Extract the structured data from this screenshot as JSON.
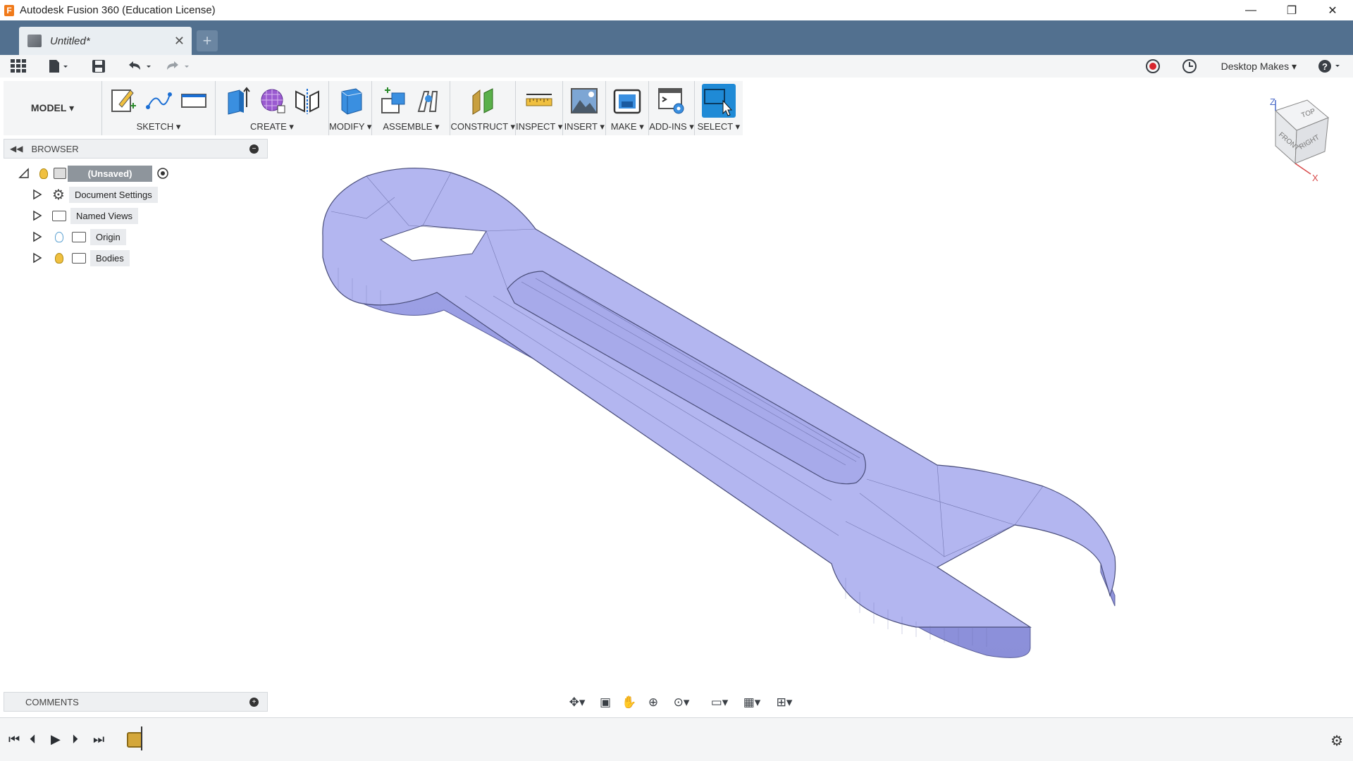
{
  "window": {
    "title": "Autodesk Fusion 360 (Education License)",
    "controls": {
      "minimize": "—",
      "restore": "❐",
      "close": "✕"
    }
  },
  "tabs": {
    "document_tab": "Untitled*",
    "close_glyph": "✕",
    "new_tab_glyph": "+"
  },
  "quick_access": {
    "workspace_menu": "Desktop Makes ▾"
  },
  "toolbar": {
    "workspace": "MODEL ▾",
    "groups": [
      {
        "label": "SKETCH ▾"
      },
      {
        "label": "CREATE ▾"
      },
      {
        "label": "MODIFY ▾"
      },
      {
        "label": "ASSEMBLE ▾"
      },
      {
        "label": "CONSTRUCT ▾"
      },
      {
        "label": "INSPECT ▾"
      },
      {
        "label": "INSERT ▾"
      },
      {
        "label": "MAKE ▾"
      },
      {
        "label": "ADD-INS ▾"
      },
      {
        "label": "SELECT ▾"
      }
    ]
  },
  "browser": {
    "title": "BROWSER",
    "root": "(Unsaved)",
    "items": [
      {
        "label": "Document Settings"
      },
      {
        "label": "Named Views"
      },
      {
        "label": "Origin"
      },
      {
        "label": "Bodies"
      }
    ]
  },
  "comments": {
    "title": "COMMENTS"
  },
  "navcube": {
    "top": "TOP",
    "front": "FRONT",
    "right": "RIGHT",
    "z": "Z",
    "x": "X"
  },
  "colors": {
    "tabbar": "#52708f",
    "model_fill": "#b3b6f0",
    "model_edge": "#4a4e7a",
    "select_active": "#1f8ad6"
  }
}
